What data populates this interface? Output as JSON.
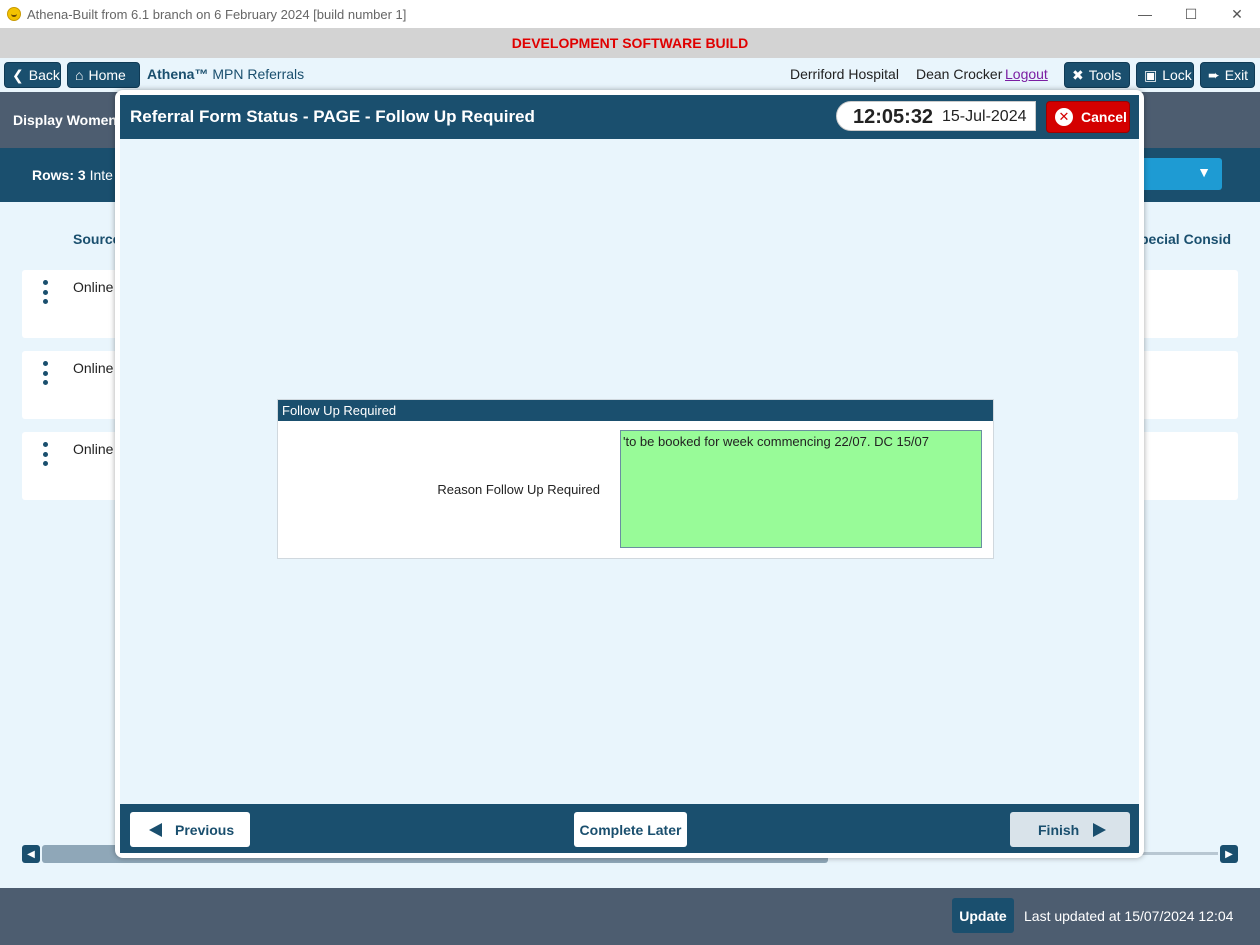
{
  "window": {
    "title": "Athena-Built from 6.1 branch on 6 February 2024 [build number 1]",
    "minimize": "—",
    "maximize": "☐",
    "close": "✕"
  },
  "banner": {
    "text": "DEVELOPMENT SOFTWARE BUILD",
    "color": "#e00000"
  },
  "nav": {
    "back_label": "Back",
    "home_label": "Home",
    "brand_name": "Athena™",
    "brand_module": "MPN Referrals",
    "hospital": "Derriford Hospital",
    "user": "Dean Crocker",
    "logout_label": "Logout",
    "tools_label": "Tools",
    "lock_label": "Lock",
    "exit_label": "Exit"
  },
  "background_page": {
    "title": "Display Women...",
    "rows_label": "Rows:",
    "rows_count": "3",
    "rows_extra": "Inte",
    "col_source": "Source",
    "col_special": "pecial Consid",
    "rows": [
      {
        "source": "Online"
      },
      {
        "source": "Online"
      },
      {
        "source": "Online"
      }
    ]
  },
  "modal": {
    "title": "Referral Form Status - PAGE - Follow Up Required",
    "time": "12:05:32",
    "date": "15-Jul-2024",
    "cancel_label": "Cancel",
    "panel": {
      "heading": "Follow Up Required",
      "field_label": "Reason Follow Up Required",
      "field_value": "'to be booked for week commencing 22/07. DC 15/07"
    },
    "previous_label": "Previous",
    "complete_later_label": "Complete Later",
    "finish_label": "Finish"
  },
  "footer": {
    "update_label": "Update",
    "last_updated": "Last updated at 15/07/2024 12:04"
  },
  "colors": {
    "primary": "#1a4f6e",
    "header_grey": "#4d5d70",
    "background": "#e9f5fc",
    "cancel_red": "#d40000",
    "field_green": "#98fb98"
  },
  "icons": [
    "app-icon",
    "back-arrow-icon",
    "home-icon",
    "tools-icon",
    "lock-icon",
    "exit-icon",
    "close-circle-icon",
    "kebab-icon",
    "triangle-left-icon",
    "triangle-right-icon",
    "dropdown-arrow-icon",
    "scroll-left-icon",
    "scroll-right-icon"
  ]
}
